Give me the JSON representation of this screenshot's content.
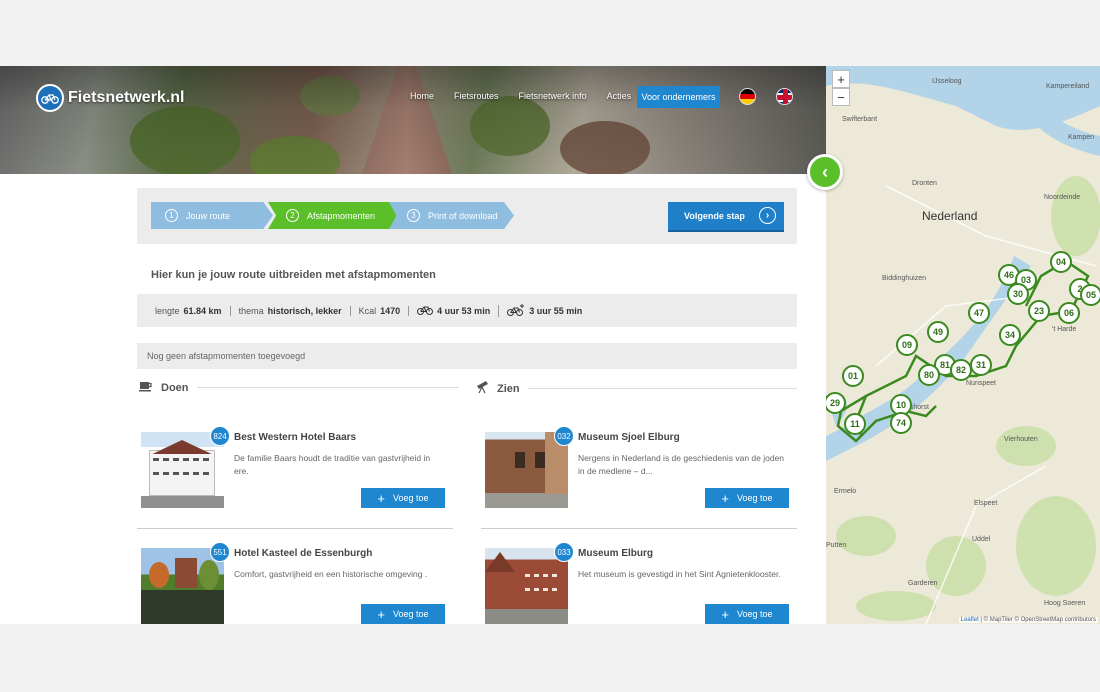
{
  "header": {
    "logo_text": "Fietsnetwerk.nl",
    "nav": [
      "Home",
      "Fietsroutes",
      "Fietsnetwerk info",
      "Acties"
    ],
    "cta": "Voor ondernemers",
    "flags": [
      "flag-de-icon",
      "flag-uk-icon"
    ]
  },
  "steps": {
    "items": [
      {
        "num": "1",
        "label": "Jouw route"
      },
      {
        "num": "2",
        "label": "Afstapmomenten"
      },
      {
        "num": "3",
        "label": "Print of download"
      }
    ],
    "next_label": "Volgende stap"
  },
  "intro": "Hier kun je jouw route uitbreiden met afstapmomenten",
  "stats": {
    "lengte_label": "lengte",
    "lengte": "61.84 km",
    "thema_label": "thema",
    "thema": "historisch, lekker",
    "kcal_label": "Kcal",
    "kcal": "1470",
    "bike_time": "4 uur 53 min",
    "ebike_time": "3 uur 55 min"
  },
  "empty_msg": "Nog geen afstapmomenten toegevoegd",
  "sections": {
    "doen": "Doen",
    "zien": "Zien"
  },
  "add_label": "Voeg toe",
  "cards": [
    {
      "badge": "824",
      "title": "Best Western Hotel Baars",
      "desc": "De familie Baars houdt de traditie van gastvrijheid in ere."
    },
    {
      "badge": "032",
      "title": "Museum Sjoel Elburg",
      "desc": "Nergens in Nederland is de geschiedenis van de joden in de medlene – d..."
    },
    {
      "badge": "551",
      "title": "Hotel Kasteel de Essenburgh",
      "desc": "Comfort, gastvrijheid en een historische omgeving ."
    },
    {
      "badge": "033",
      "title": "Museum Elburg",
      "desc": "Het museum is gevestigd in het Sint Agnietenklooster."
    }
  ],
  "map": {
    "labels": [
      "IJsseloog",
      "Kampereiland",
      "Swifterbant",
      "Kampen",
      "Dronten",
      "Noordeinde",
      "Biddinghuizen",
      "'t Harde",
      "Nunspeet",
      "Vierhouten",
      "Ermelo",
      "Elspeet",
      "Putten",
      "Uddel",
      "Garderen",
      "Hoog Soeren",
      "Vulshorst"
    ],
    "country": "Nederland",
    "pins": [
      "04",
      "46",
      "03",
      "30",
      "2",
      "05",
      "06",
      "23",
      "47",
      "34",
      "49",
      "09",
      "81",
      "82",
      "31",
      "80",
      "01",
      "29",
      "10",
      "74",
      "11"
    ],
    "attribution_prefix": "Leaflet",
    "attribution": " | © MapTiler © OpenStreetMap contributors"
  }
}
